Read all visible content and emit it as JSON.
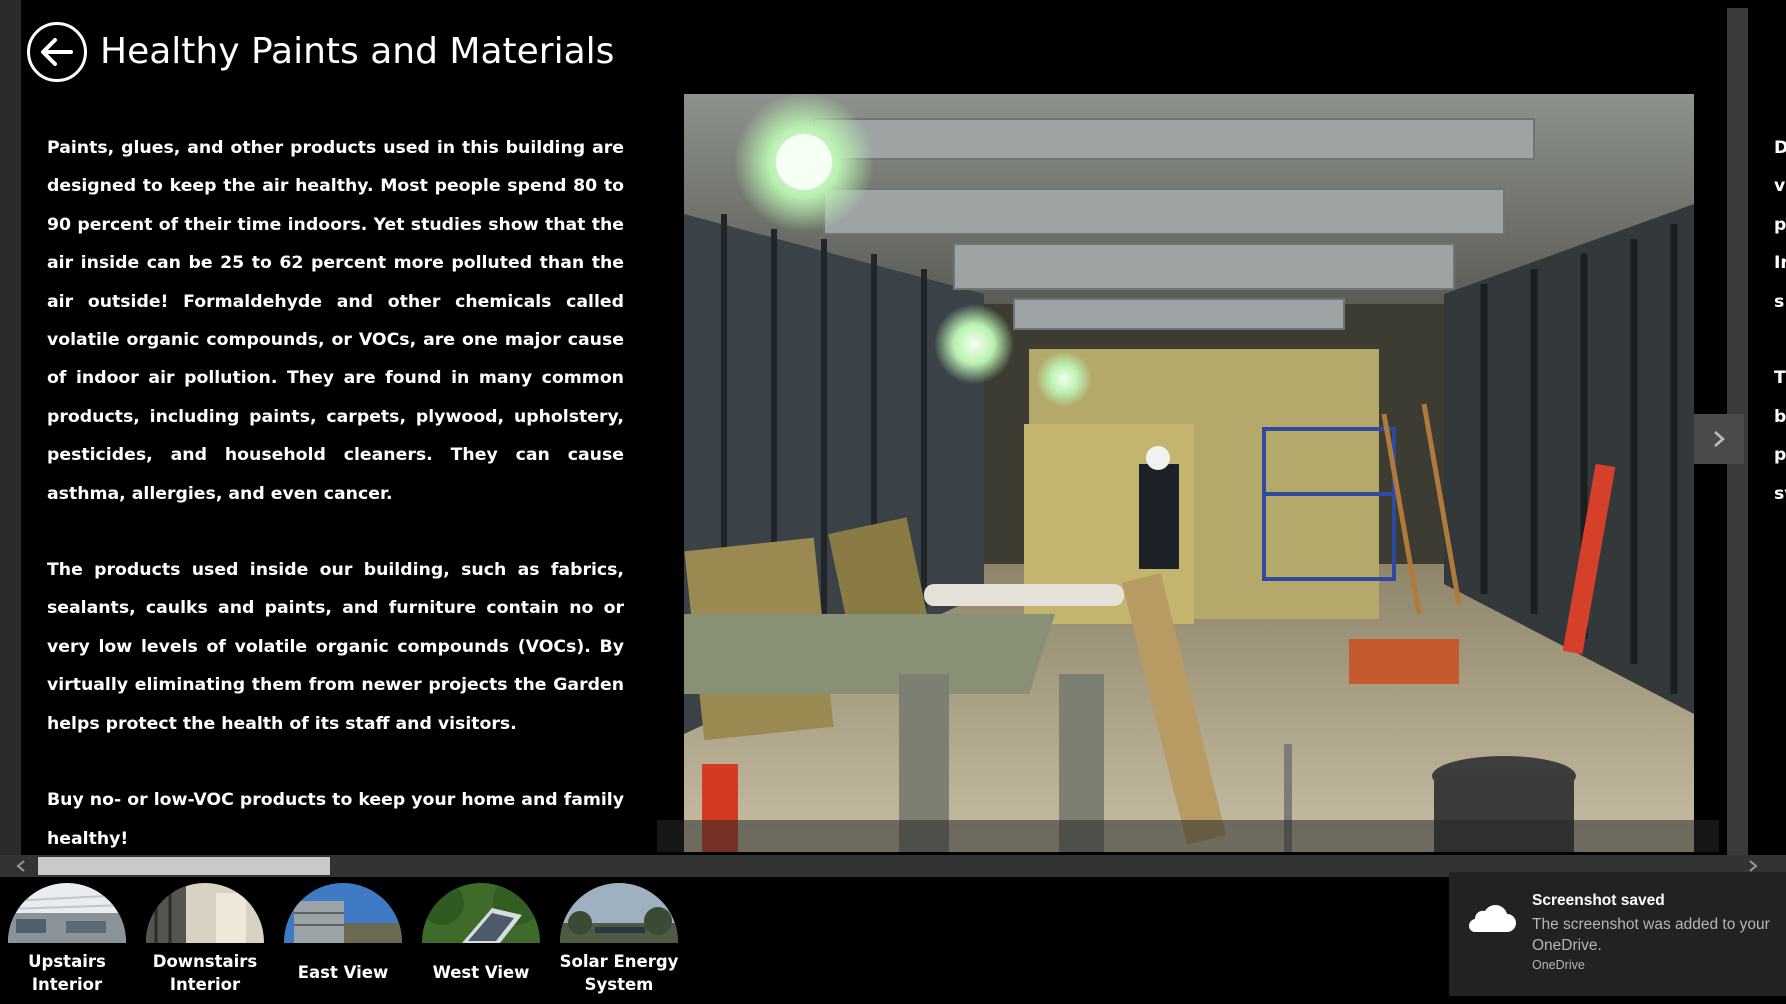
{
  "header": {
    "title": "Healthy Paints and Materials",
    "back_icon": "back-arrow-icon"
  },
  "article": {
    "paragraphs": [
      "Paints, glues, and other products used in this building are designed to keep the air healthy. Most people spend 80 to 90 percent of their time indoors. Yet studies show that the air inside can be 25 to 62 percent more polluted than the air outside! Formaldehyde and other chemicals called volatile organic compounds, or VOCs, are one major cause of indoor air pollution. They are found in many common products, including paints, carpets, plywood, upholstery, pesticides, and household cleaners. They can cause asthma, allergies, and even cancer.",
      "The products used inside our building, such as fabrics, sealants, caulks and paints, and furniture contain no or very low levels of volatile organic compounds (VOCs). By virtually eliminating them from newer projects the Garden helps protect the health of its staff and visitors.",
      "Buy no- or low-VOC products to keep your home and family healthy!"
    ]
  },
  "next_section_peek": [
    "D",
    "v",
    "p",
    "Ir",
    "s",
    "",
    "T",
    "b",
    "p",
    "sy"
  ],
  "thumbnails": [
    {
      "label": "Upstairs Interior",
      "icon": "upstairs-interior-thumbnail"
    },
    {
      "label": "Downstairs Interior",
      "icon": "downstairs-interior-thumbnail"
    },
    {
      "label": "East View",
      "icon": "east-view-thumbnail"
    },
    {
      "label": "West View",
      "icon": "west-view-thumbnail"
    },
    {
      "label": "Solar Energy System",
      "icon": "solar-energy-thumbnail"
    }
  ],
  "toast": {
    "title": "Screenshot saved",
    "body": "The screenshot was added to your OneDrive.",
    "source": "OneDrive",
    "icon": "onedrive-cloud-icon"
  },
  "colors": {
    "background": "#000000",
    "scrollbar": "#333333",
    "thumb": "#c9c9c9",
    "toast_bg": "#222222"
  }
}
